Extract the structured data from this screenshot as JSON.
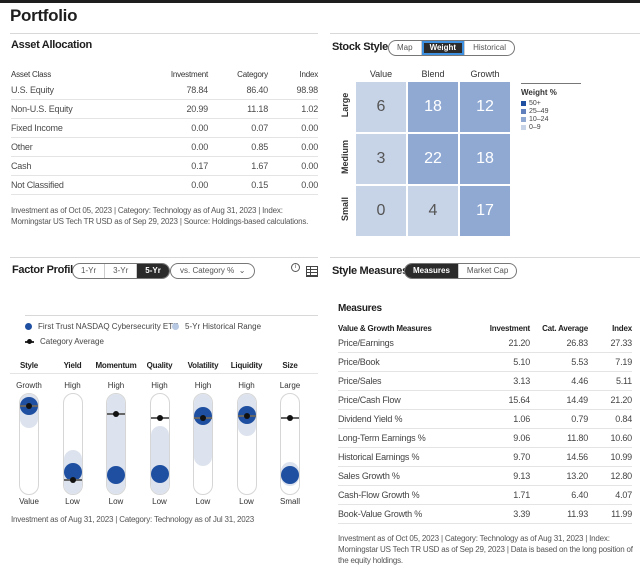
{
  "page": {
    "title": "Portfolio"
  },
  "asset_allocation": {
    "title": "Asset Allocation",
    "headers": [
      "Asset Class",
      "Investment",
      "Category",
      "Index"
    ],
    "rows": [
      [
        "U.S. Equity",
        "78.84",
        "86.40",
        "98.98"
      ],
      [
        "Non-U.S. Equity",
        "20.99",
        "11.18",
        "1.02"
      ],
      [
        "Fixed Income",
        "0.00",
        "0.07",
        "0.00"
      ],
      [
        "Other",
        "0.00",
        "0.85",
        "0.00"
      ],
      [
        "Cash",
        "0.17",
        "1.67",
        "0.00"
      ],
      [
        "Not Classified",
        "0.00",
        "0.15",
        "0.00"
      ]
    ],
    "footnote": "Investment as of Oct 05, 2023 | Category: Technology as of Aug 31, 2023 | Index: Morningstar US Tech TR USD as of Sep 29, 2023 | Source: Holdings-based calculations."
  },
  "stock_style": {
    "title": "Stock Style",
    "tabs": [
      {
        "label": "Map",
        "active": false
      },
      {
        "label": "Weight",
        "active": true
      },
      {
        "label": "Historical",
        "active": false
      }
    ],
    "columns": [
      "Value",
      "Blend",
      "Growth"
    ],
    "rows": [
      "Large",
      "Medium",
      "Small"
    ],
    "grid": [
      [
        6,
        18,
        12
      ],
      [
        3,
        22,
        18
      ],
      [
        0,
        4,
        17
      ]
    ],
    "legend": {
      "title": "Weight %",
      "items": [
        {
          "label": "50+",
          "color": "#1f4fa0"
        },
        {
          "label": "25–49",
          "color": "#5f80bd"
        },
        {
          "label": "10–24",
          "color": "#8fa9d3"
        },
        {
          "label": "0–9",
          "color": "#c7d3e7"
        }
      ]
    }
  },
  "factor_profile": {
    "title": "Factor Profile",
    "periods": [
      {
        "label": "1-Yr",
        "active": false
      },
      {
        "label": "3-Yr",
        "active": false
      },
      {
        "label": "5-Yr",
        "active": true
      }
    ],
    "compare_dropdown": "vs. Category %",
    "legend": {
      "investment": "First Trust NASDAQ Cybersecurity ETF",
      "range": "5-Yr Historical Range",
      "category": "Category Average"
    },
    "factors": [
      {
        "name": "Style",
        "high": "Growth",
        "low": "Value",
        "investment_pct": 88,
        "category_pct": 88,
        "range_pct": [
          68,
          100
        ]
      },
      {
        "name": "Yield",
        "high": "High",
        "low": "Low",
        "investment_pct": 22,
        "category_pct": 14,
        "range_pct": [
          0,
          42
        ]
      },
      {
        "name": "Momentum",
        "high": "High",
        "low": "Low",
        "investment_pct": 19,
        "category_pct": 80,
        "range_pct": [
          0,
          100
        ]
      },
      {
        "name": "Quality",
        "high": "High",
        "low": "Low",
        "investment_pct": 20,
        "category_pct": 76,
        "range_pct": [
          0,
          66
        ]
      },
      {
        "name": "Volatility",
        "high": "High",
        "low": "Low",
        "investment_pct": 78,
        "category_pct": 76,
        "range_pct": [
          30,
          100
        ]
      },
      {
        "name": "Liquidity",
        "high": "High",
        "low": "Low",
        "investment_pct": 79,
        "category_pct": 78,
        "range_pct": [
          60,
          100
        ]
      },
      {
        "name": "Size",
        "high": "Large",
        "low": "Small",
        "investment_pct": 19,
        "category_pct": 76,
        "range_pct": [
          10,
          30
        ]
      }
    ],
    "footnote": "Investment as of Aug 31, 2023 | Category: Technology as of Jul 31, 2023"
  },
  "style_measures": {
    "title": "Style Measures",
    "tabs": [
      {
        "label": "Measures",
        "active": true
      },
      {
        "label": "Market Cap",
        "active": false
      }
    ],
    "subtitle": "Measures",
    "headers": [
      "Value & Growth Measures",
      "Investment",
      "Cat. Average",
      "Index"
    ],
    "rows": [
      [
        "Price/Earnings",
        "21.20",
        "26.83",
        "27.33"
      ],
      [
        "Price/Book",
        "5.10",
        "5.53",
        "7.19"
      ],
      [
        "Price/Sales",
        "3.13",
        "4.46",
        "5.11"
      ],
      [
        "Price/Cash Flow",
        "15.64",
        "14.49",
        "21.20"
      ],
      [
        "Dividend Yield %",
        "1.06",
        "0.79",
        "0.84"
      ],
      [
        "Long-Term Earnings %",
        "9.06",
        "11.80",
        "10.60"
      ],
      [
        "Historical Earnings %",
        "9.70",
        "14.56",
        "10.99"
      ],
      [
        "Sales Growth %",
        "9.13",
        "13.20",
        "12.80"
      ],
      [
        "Cash-Flow Growth %",
        "1.71",
        "6.40",
        "4.07"
      ],
      [
        "Book-Value Growth %",
        "3.39",
        "11.93",
        "11.99"
      ]
    ],
    "footnote": "Investment as of Oct 05, 2023 | Category: Technology as of Aug 31, 2023 | Index: Morningstar US Tech TR USD as of Sep 29, 2023 | Data is based on the long position of the equity holdings."
  }
}
